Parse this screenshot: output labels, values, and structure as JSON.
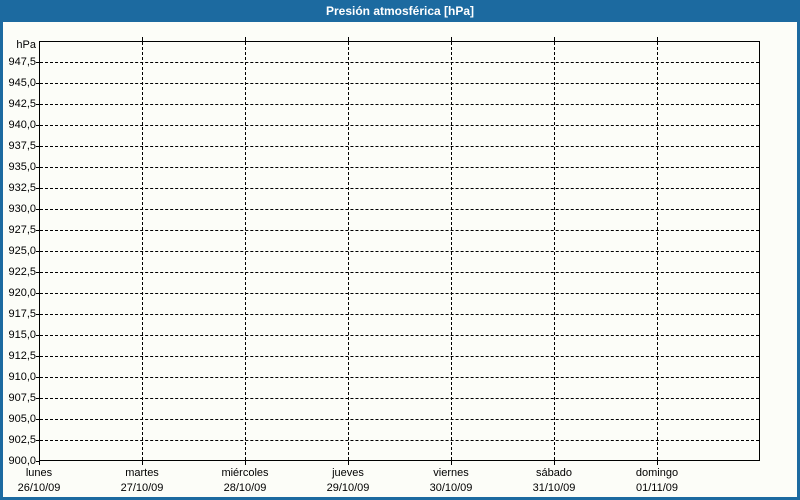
{
  "title_bar": {
    "title": "Presión atmosférica [hPa]"
  },
  "colors": {
    "accent_blue": "#1C6AA0",
    "background": "#FCFDF8",
    "grid": "#000000",
    "text": "#000000",
    "title_text": "#FFFFFF"
  },
  "chart_data": {
    "type": "line",
    "title": "Presión atmosférica [hPa]",
    "ylabel": "hPa",
    "ylim": [
      900,
      950
    ],
    "y_tick_step": 2.5,
    "y_tick_values": [
      947.5,
      945.0,
      942.5,
      940.0,
      937.5,
      935.0,
      932.5,
      930.0,
      927.5,
      925.0,
      922.5,
      920.0,
      917.5,
      915.0,
      912.5,
      910.0,
      907.5,
      905.0,
      902.5,
      900.0
    ],
    "y_tick_labels": [
      "947,5",
      "945,0",
      "942,5",
      "940,0",
      "937,5",
      "935,0",
      "932,5",
      "930,0",
      "927,5",
      "925,0",
      "922,5",
      "920,0",
      "917,5",
      "915,0",
      "912,5",
      "910,0",
      "907,5",
      "905,0",
      "902,5",
      "900,0"
    ],
    "x_categories": [
      {
        "day": "lunes",
        "date": "26/10/09"
      },
      {
        "day": "martes",
        "date": "27/10/09"
      },
      {
        "day": "miércoles",
        "date": "28/10/09"
      },
      {
        "day": "jueves",
        "date": "29/10/09"
      },
      {
        "day": "viernes",
        "date": "30/10/09"
      },
      {
        "day": "sábado",
        "date": "31/10/09"
      },
      {
        "day": "domingo",
        "date": "01/11/09"
      }
    ],
    "grid": "dashed",
    "legend": "none",
    "series": []
  }
}
